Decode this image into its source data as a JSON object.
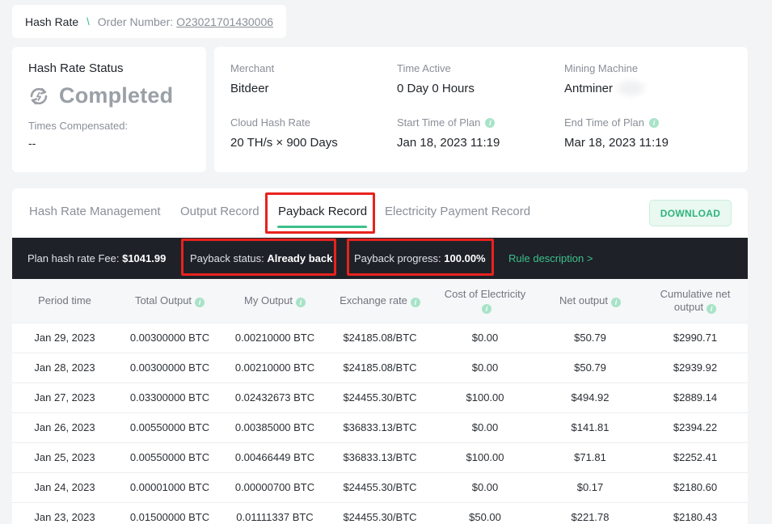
{
  "breadcrumb": {
    "home": "Hash Rate",
    "separator": "\\",
    "order_label": "Order Number:",
    "order_number": "O23021701430006"
  },
  "status": {
    "title": "Hash Rate Status",
    "icon": "refresh-cycle-icon",
    "value": "Completed",
    "times_label": "Times Compensated:",
    "times_value": "--"
  },
  "info": {
    "merchant_label": "Merchant",
    "merchant": "Bitdeer",
    "time_active_label": "Time Active",
    "time_active": "0 Day 0 Hours",
    "machine_label": "Mining Machine",
    "machine": "Antminer",
    "cloud_label": "Cloud Hash Rate",
    "cloud": "20 TH/s × 900 Days",
    "start_label": "Start Time of Plan",
    "start": "Jan 18, 2023 11:19",
    "end_label": "End Time of Plan",
    "end": "Mar 18, 2023 11:19"
  },
  "tabs": [
    "Hash Rate Management",
    "Output Record",
    "Payback Record",
    "Electricity Payment Record"
  ],
  "active_tab": "Payback Record",
  "download_label": "DOWNLOAD",
  "summary": {
    "fee_label": "Plan hash rate Fee:",
    "fee": "$1041.99",
    "payback_status_label": "Payback status:",
    "payback_status": "Already back",
    "payback_progress_label": "Payback progress:",
    "payback_progress": "100.00%",
    "rule_link": "Rule description >"
  },
  "table": {
    "headers": [
      "Period time",
      "Total Output",
      "My Output",
      "Exchange rate",
      "Cost of Electricity",
      "Net output",
      "Cumulative net output"
    ],
    "rows": [
      [
        "Jan 29, 2023",
        "0.00300000 BTC",
        "0.00210000 BTC",
        "$24185.08/BTC",
        "$0.00",
        "$50.79",
        "$2990.71"
      ],
      [
        "Jan 28, 2023",
        "0.00300000 BTC",
        "0.00210000 BTC",
        "$24185.08/BTC",
        "$0.00",
        "$50.79",
        "$2939.92"
      ],
      [
        "Jan 27, 2023",
        "0.03300000 BTC",
        "0.02432673 BTC",
        "$24455.30/BTC",
        "$100.00",
        "$494.92",
        "$2889.14"
      ],
      [
        "Jan 26, 2023",
        "0.00550000 BTC",
        "0.00385000 BTC",
        "$36833.13/BTC",
        "$0.00",
        "$141.81",
        "$2394.22"
      ],
      [
        "Jan 25, 2023",
        "0.00550000 BTC",
        "0.00466449 BTC",
        "$36833.13/BTC",
        "$100.00",
        "$71.81",
        "$2252.41"
      ],
      [
        "Jan 24, 2023",
        "0.00001000 BTC",
        "0.00000700 BTC",
        "$24455.30/BTC",
        "$0.00",
        "$0.17",
        "$2180.60"
      ],
      [
        "Jan 23, 2023",
        "0.01500000 BTC",
        "0.01111337 BTC",
        "$24455.30/BTC",
        "$50.00",
        "$221.78",
        "$2180.43"
      ]
    ]
  },
  "colors": {
    "accent": "#3cc08a",
    "highlight": "#e8221e",
    "bar_bg": "#1e2128"
  }
}
